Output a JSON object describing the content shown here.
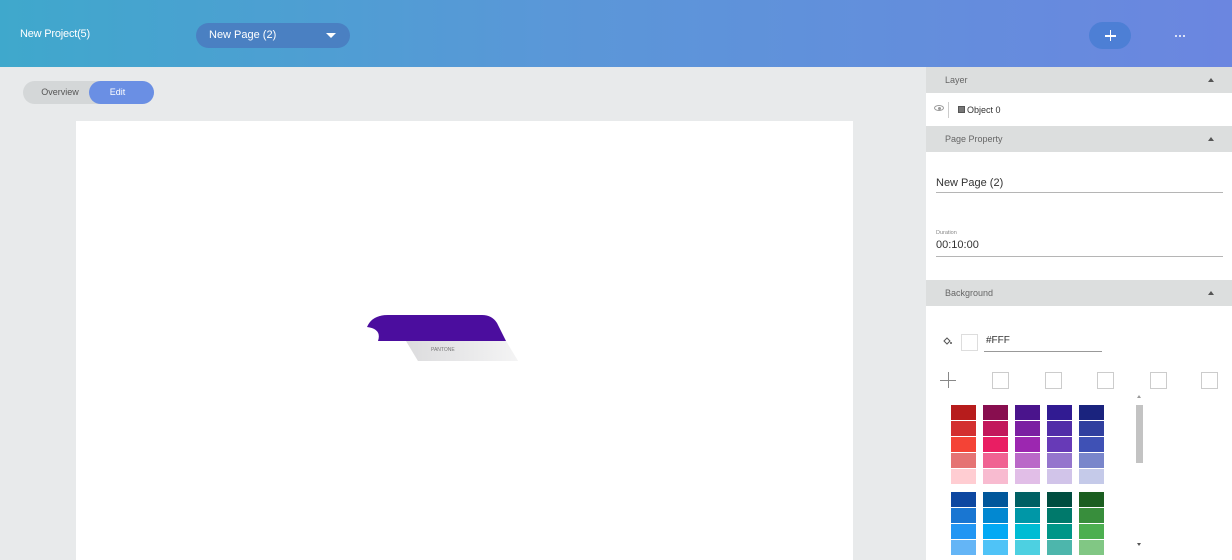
{
  "header": {
    "project_title": "New Project(5)",
    "page_selector": "New Page (2)",
    "add_icon": "plus-icon",
    "more_icon": "more-horizontal-icon"
  },
  "view_toggle": {
    "overview": "Overview",
    "edit": "Edit",
    "active": "Edit"
  },
  "canvas": {
    "ribbon_text": "PANTONE",
    "ribbon_color": "#4B0D9E"
  },
  "panel": {
    "layer": {
      "title": "Layer",
      "object_name": "Object 0"
    },
    "page_property": {
      "title": "Page Property",
      "page_name": "New Page (2)",
      "duration_label": "Duration",
      "duration_value": "00:10:00"
    },
    "background": {
      "title": "Background",
      "hex_value": "#FFF"
    },
    "palette": [
      [
        "#B71C1C",
        "#880E4F",
        "#4A148C",
        "#311B92",
        "#1A237E"
      ],
      [
        "#D32F2F",
        "#C2185B",
        "#7B1FA2",
        "#512DA8",
        "#303F9F"
      ],
      [
        "#F44336",
        "#E91E63",
        "#9C27B0",
        "#673AB7",
        "#3F51B5"
      ],
      [
        "#E57373",
        "#F06292",
        "#BA68C8",
        "#9575CD",
        "#7986CB"
      ],
      [
        "#FFCDD2",
        "#F8BBD0",
        "#E1BEE7",
        "#D1C4E9",
        "#C5CAE9"
      ],
      [
        "#0D47A1",
        "#01579B",
        "#006064",
        "#004D40",
        "#1B5E20"
      ],
      [
        "#1976D2",
        "#0288D1",
        "#0097A7",
        "#00796B",
        "#388E3C"
      ],
      [
        "#2196F3",
        "#03A9F4",
        "#00BCD4",
        "#009688",
        "#4CAF50"
      ],
      [
        "#64B5F6",
        "#4FC3F7",
        "#4DD0E1",
        "#4DB6AC",
        "#81C784"
      ]
    ]
  }
}
